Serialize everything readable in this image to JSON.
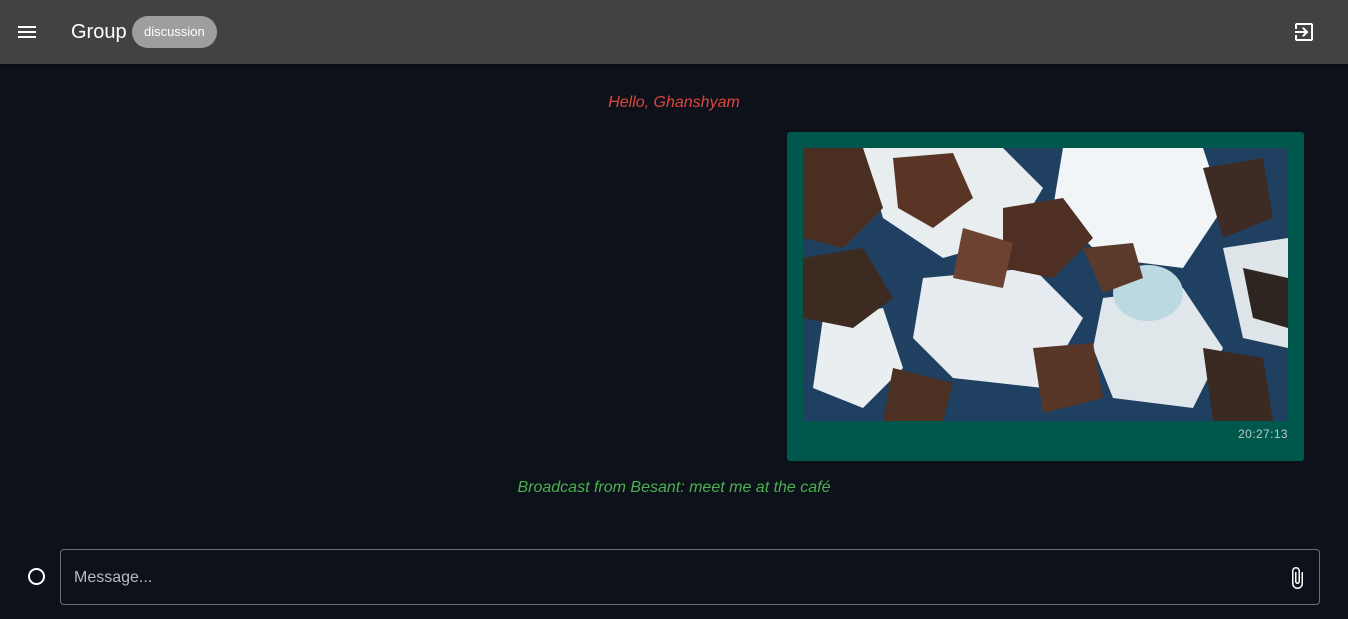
{
  "header": {
    "title": "Group",
    "chip": "discussion",
    "menu_icon": "menu-icon",
    "logout_icon": "exit-to-app-icon",
    "background": "#424242"
  },
  "messages": {
    "greeting": "Hello, Ghanshyam",
    "image_message": {
      "timestamp": "20:27:13",
      "bubble_color": "#00574b"
    },
    "broadcast": "Broadcast from Besant: meet me at the café"
  },
  "composer": {
    "placeholder": "Message...",
    "value": "",
    "attach_icon": "paperclip-icon",
    "status_icon": "circle-outline-icon"
  },
  "colors": {
    "background": "#0d121a",
    "greeting_text": "#e0443e",
    "broadcast_text": "#4caf50"
  }
}
